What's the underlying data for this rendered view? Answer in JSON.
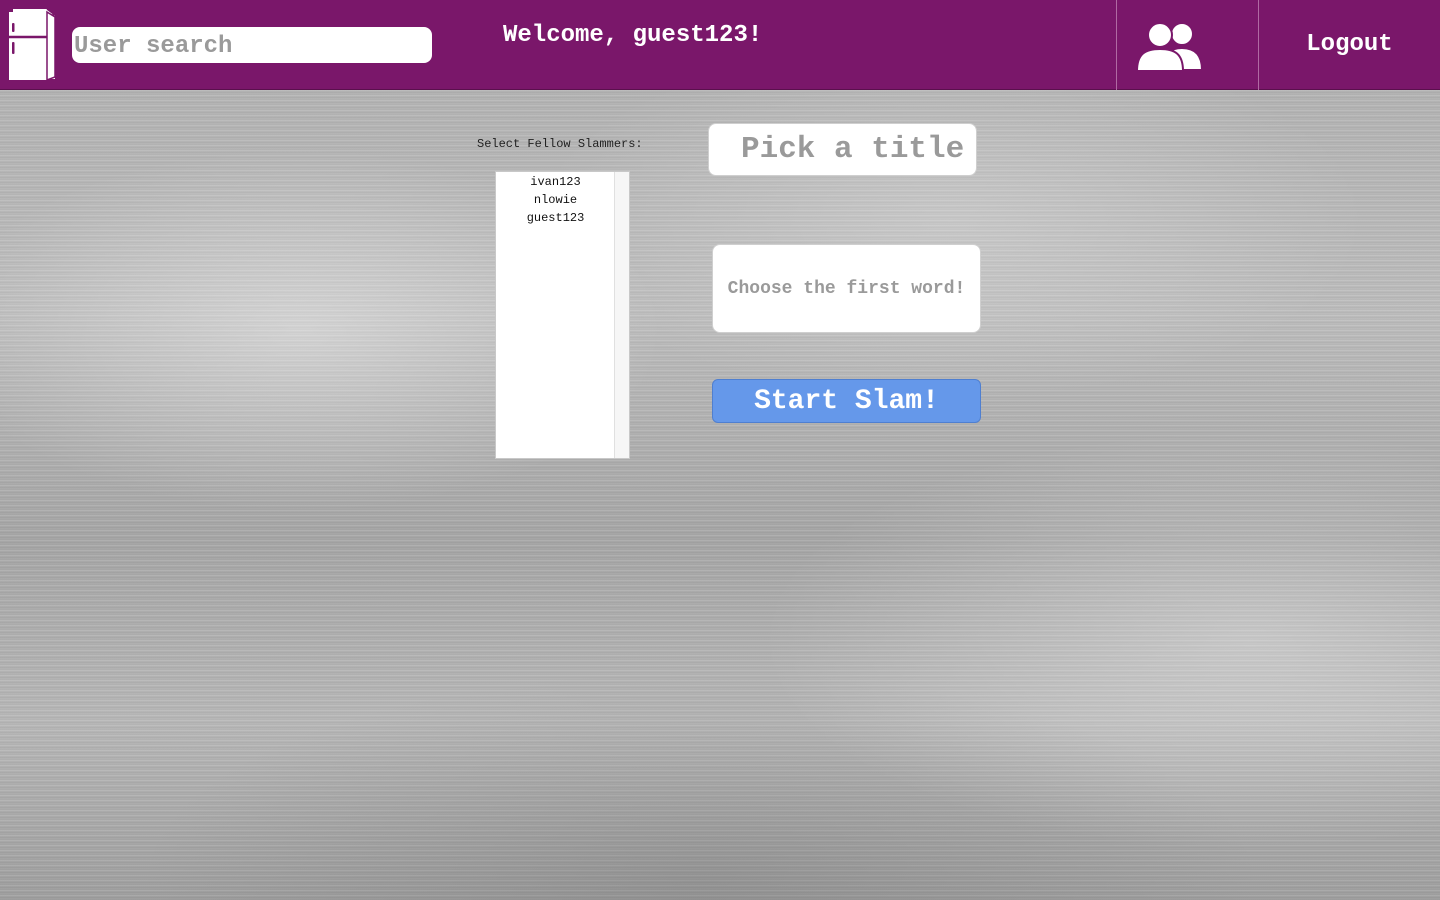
{
  "header": {
    "logo_icon": "refrigerator-icon",
    "search_placeholder": "User search",
    "search_value": "",
    "welcome_text": "Welcome, guest123!",
    "friends_icon": "users-icon",
    "logout_label": "Logout",
    "bg_color": "#7a176a"
  },
  "form": {
    "select_label": "Select Fellow Slammers:",
    "users": [
      "ivan123",
      "nlowie",
      "guest123"
    ],
    "title_placeholder": "Pick a title",
    "title_value": "",
    "first_word_placeholder": "Choose the first word!",
    "first_word_value": "",
    "start_label": "Start Slam!",
    "start_color": "#6598ea"
  }
}
